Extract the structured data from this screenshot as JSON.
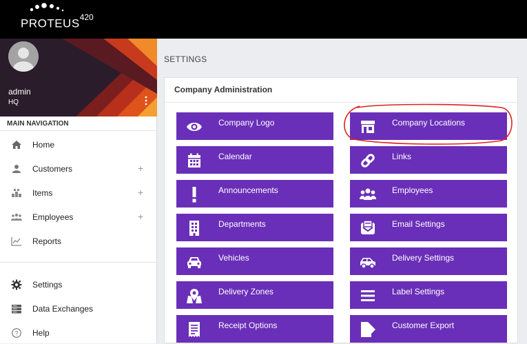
{
  "app": {
    "logo_text": "PROTEUS",
    "logo_suffix": "420"
  },
  "user": {
    "name": "admin",
    "location": "HQ"
  },
  "nav": {
    "header": "MAIN NAVIGATION",
    "items": [
      {
        "label": "Home",
        "icon": "home-icon",
        "expandable": false
      },
      {
        "label": "Customers",
        "icon": "person-icon",
        "expandable": true
      },
      {
        "label": "Items",
        "icon": "items-icon",
        "expandable": true
      },
      {
        "label": "Employees",
        "icon": "group-icon",
        "expandable": true
      },
      {
        "label": "Reports",
        "icon": "chart-icon",
        "expandable": false
      },
      {
        "label": "Settings",
        "icon": "gear-icon",
        "expandable": false
      },
      {
        "label": "Data Exchanges",
        "icon": "database-icon",
        "expandable": false
      },
      {
        "label": "Help",
        "icon": "help-icon",
        "expandable": false
      }
    ],
    "plus_symbol": "+"
  },
  "page": {
    "title": "SETTINGS",
    "section_title": "Company Administration"
  },
  "tiles": [
    {
      "label": "Company Logo",
      "icon": "eye-icon"
    },
    {
      "label": "Company Locations",
      "icon": "store-icon"
    },
    {
      "label": "Calendar",
      "icon": "calendar-icon"
    },
    {
      "label": "Links",
      "icon": "link-icon"
    },
    {
      "label": "Announcements",
      "icon": "exclamation-icon"
    },
    {
      "label": "Employees",
      "icon": "group-icon"
    },
    {
      "label": "Departments",
      "icon": "building-icon"
    },
    {
      "label": "Email Settings",
      "icon": "email-icon"
    },
    {
      "label": "Vehicles",
      "icon": "car-icon"
    },
    {
      "label": "Delivery Settings",
      "icon": "car-side-icon"
    },
    {
      "label": "Delivery Zones",
      "icon": "map-marker-icon"
    },
    {
      "label": "Label Settings",
      "icon": "lines-icon"
    },
    {
      "label": "Receipt Options",
      "icon": "receipt-icon"
    },
    {
      "label": "Customer Export",
      "icon": "export-icon"
    }
  ],
  "colors": {
    "tile": "#6a2fb8",
    "topbar": "#000000",
    "annotation": "#e02020"
  }
}
